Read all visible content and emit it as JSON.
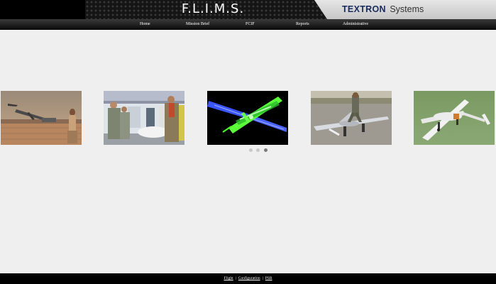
{
  "header": {
    "app_title": "F.L.I.M.S.",
    "brand_bold": "TEXTRON",
    "brand_rest": "Systems"
  },
  "nav": {
    "items": [
      "Home",
      "Mission Brief",
      "FCIF",
      "Reports",
      "Administrative"
    ]
  },
  "carousel": {
    "slides": [
      {
        "name": "uav-field-launch-photo"
      },
      {
        "name": "soldiers-tent-display-photo"
      },
      {
        "name": "uav-wireframe-render"
      },
      {
        "name": "soldier-with-uav-runway-photo"
      },
      {
        "name": "uav-on-grass-photo"
      }
    ],
    "pager_count": 3,
    "active_page": 3
  },
  "footer": {
    "links": [
      "Flight",
      "Configuration",
      "PSR"
    ],
    "separator": "|"
  },
  "colors": {
    "page_bg": "#efefef",
    "header_bg": "#000000",
    "brand_blue": "#1a2b5e"
  }
}
